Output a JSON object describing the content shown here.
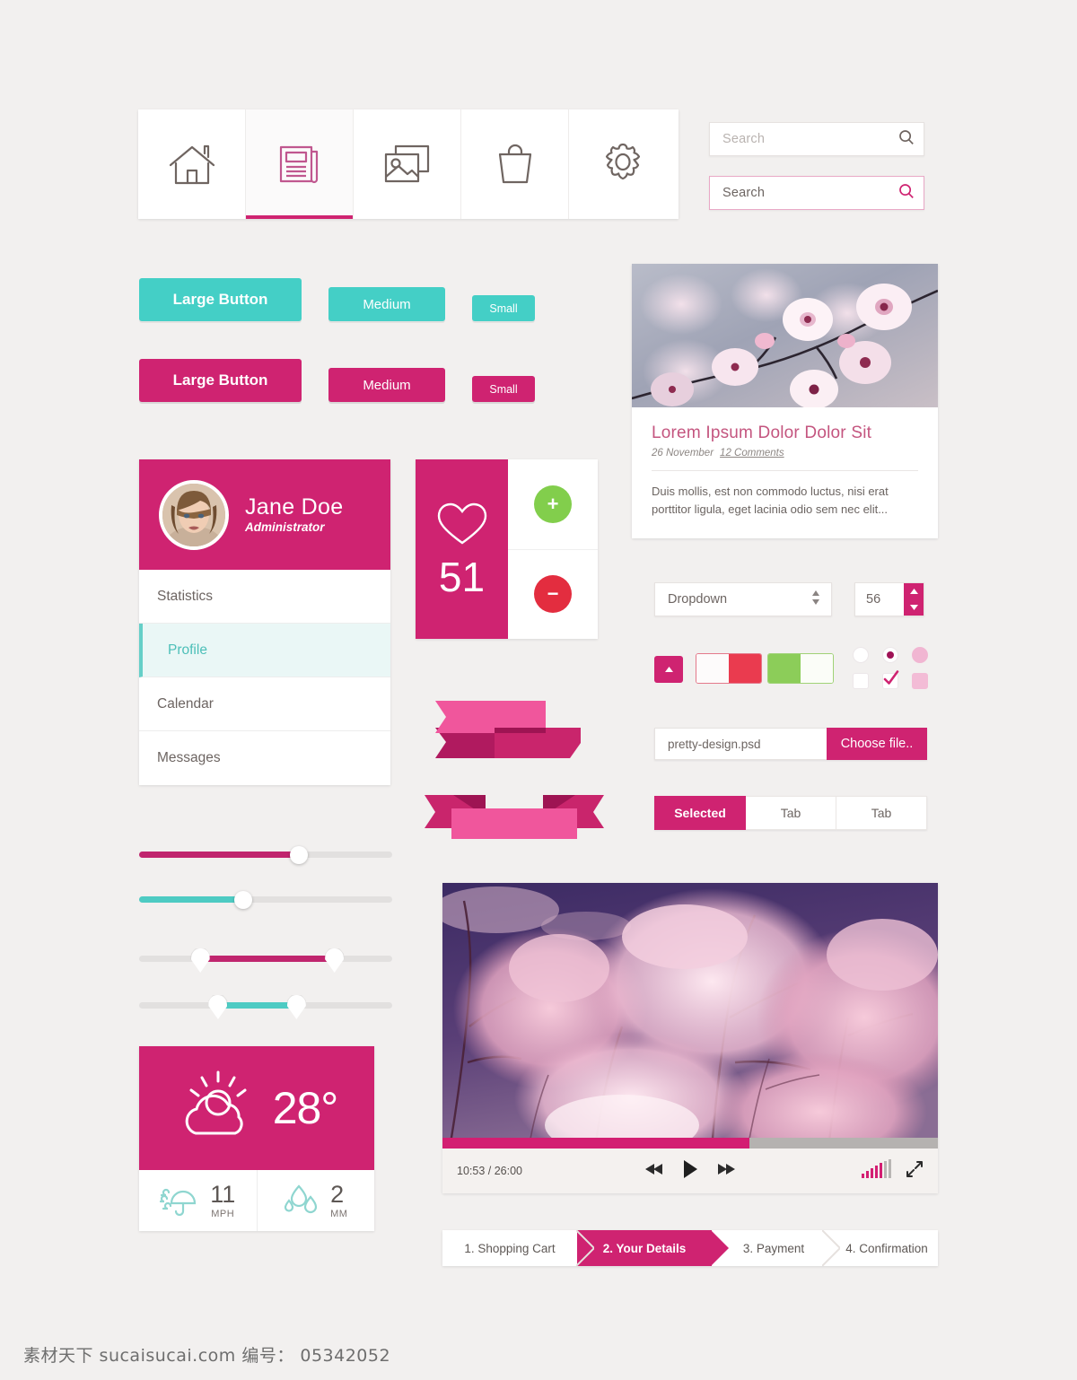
{
  "nav": {
    "tabs": [
      {
        "icon": "home-icon",
        "active": false
      },
      {
        "icon": "news-icon",
        "active": true
      },
      {
        "icon": "gallery-icon",
        "active": false
      },
      {
        "icon": "bag-icon",
        "active": false
      },
      {
        "icon": "gear-icon",
        "active": false
      }
    ]
  },
  "search": {
    "default_placeholder": "Search",
    "focused_value": "Search",
    "icon": "magnifier-icon"
  },
  "buttons": {
    "teal_large": "Large Button",
    "teal_medium": "Medium",
    "teal_small": "Small",
    "pink_large": "Large Button",
    "pink_medium": "Medium",
    "pink_small": "Small"
  },
  "profile": {
    "name": "Jane Doe",
    "role": "Administrator",
    "menu": [
      {
        "label": "Statistics",
        "active": false
      },
      {
        "label": "Profile",
        "active": true
      },
      {
        "label": "Calendar",
        "active": false
      },
      {
        "label": "Messages",
        "active": false
      }
    ]
  },
  "likes": {
    "icon": "heart-icon",
    "count": "51",
    "plus_label": "+",
    "minus_label": "−"
  },
  "blog": {
    "image_alt": "cherry-blossom-photo",
    "title": "Lorem Ipsum Dolor Dolor Sit",
    "date": "26 November",
    "comments": "12 Comments",
    "excerpt": "Duis mollis, est non commodo luctus, nisi erat porttitor ligula, eget lacinia odio sem nec elit..."
  },
  "form": {
    "dropdown_value": "Dropdown",
    "spinner_value": "56",
    "file_name": "pretty-design.psd",
    "file_button": "Choose file..",
    "tabs": [
      {
        "label": "Selected",
        "selected": true
      },
      {
        "label": "Tab",
        "selected": false
      },
      {
        "label": "Tab",
        "selected": false
      }
    ],
    "toggles": [
      {
        "name": "toggle-pink",
        "state": "on",
        "color": "#cf2371"
      },
      {
        "name": "toggle-red",
        "state": "on",
        "color": "#ea3b4f"
      },
      {
        "name": "toggle-green",
        "state": "off",
        "color": "#8ccd59"
      }
    ],
    "radios": [
      {
        "state": "unchecked"
      },
      {
        "state": "checked"
      },
      {
        "state": "disabled"
      }
    ],
    "checkboxes": [
      {
        "state": "unchecked"
      },
      {
        "state": "checked"
      },
      {
        "state": "disabled"
      }
    ]
  },
  "weather": {
    "condition_icon": "sun-behind-cloud-icon",
    "temperature": "28°",
    "wind": {
      "icon": "windy-umbrella-icon",
      "value": "11",
      "unit": "MPH"
    },
    "rain": {
      "icon": "raindrop-icon",
      "value": "2",
      "unit": "MM"
    }
  },
  "sliders": [
    {
      "name": "slider-pink-single",
      "fill_color": "#c0256e",
      "value_pct": 63,
      "style": "round"
    },
    {
      "name": "slider-teal-single",
      "fill_color": "#4ecbc3",
      "value_pct": 41,
      "style": "round"
    },
    {
      "name": "slider-pink-range",
      "fill_color": "#c0256e",
      "low_pct": 24,
      "high_pct": 77,
      "style": "pin"
    },
    {
      "name": "slider-teal-range",
      "fill_color": "#4ecbc3",
      "low_pct": 31,
      "high_pct": 62,
      "style": "pin"
    }
  ],
  "video": {
    "image_alt": "pink-infrared-tree-photo",
    "current_time": "10:53",
    "total_time": "26:00",
    "time_display": "10:53 / 26:00",
    "progress_pct": 62,
    "controls": {
      "rewind": "rewind-icon",
      "play": "play-icon",
      "forward": "fast-forward-icon",
      "volume": "volume-bars-icon",
      "fullscreen": "fullscreen-icon"
    },
    "volume_level": 5,
    "volume_max": 7
  },
  "steps": [
    {
      "label": "1. Shopping Cart",
      "active": false
    },
    {
      "label": "2. Your Details",
      "active": true
    },
    {
      "label": "3. Payment",
      "active": false
    },
    {
      "label": "4. Confirmation",
      "active": false
    }
  ],
  "watermark": "素材天下 sucaisucai.com  编号： 05342052",
  "colors": {
    "pink": "#cf2371",
    "pink_light": "#f0569c",
    "teal": "#44cfc6",
    "green": "#82ce4c",
    "red": "#e32d3f",
    "background": "#f2f0ef"
  }
}
